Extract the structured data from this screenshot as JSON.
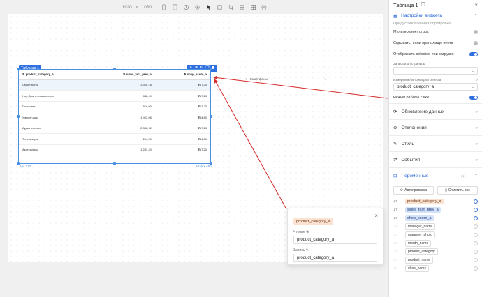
{
  "toolbar": {
    "width": "1920",
    "times": "×",
    "height": "1080",
    "code_icon_label": "{x}"
  },
  "widget": {
    "tag": "Таблица 1",
    "size_left": "1px 310",
    "size_right": "1016 × 460",
    "columns": [
      "product_category_a",
      "sales_fact_prev_a",
      "shop_score_a"
    ],
    "rows": [
      [
        "Смартфоны",
        "3 328,18",
        "₽17,20"
      ],
      [
        "Ноутбуки и компьютеры",
        "842,49",
        "₽17,20"
      ],
      [
        "Планшеты",
        "518,00",
        "₽17,20"
      ],
      [
        "Умные часы",
        "1 422,96",
        "₽44,80"
      ],
      [
        "Аудиотехника",
        "2 332,92",
        "₽17,20"
      ],
      [
        "Телевизоры",
        "264,59",
        "₽44,80"
      ],
      [
        "Аксессуары",
        "1 233,40",
        "₽17,20"
      ]
    ]
  },
  "filter_widget": {
    "label": "Смартфоны"
  },
  "popup": {
    "chip": "product_category_a",
    "read_label": "Чтение",
    "read_value": "product_category_a",
    "write_label": "Запись",
    "write_value": "product_category_a"
  },
  "panel": {
    "title": "Таблица 1",
    "settings_header": "Настройки виджета",
    "cut_row": "Предустановленная сортировка",
    "multiselect": "Мультиселект строк",
    "hide_empty": "Скрывать, если хранилище пусто",
    "show_selected": "Отображать selected при загрузке",
    "url_label": "Запись в url страницы",
    "dimension_label": "Измерение/метрика для селекта",
    "dimension_value": "product_category_a",
    "like_mode": "Режим работы с like",
    "data_update": "Обновление данных",
    "deviations": "Отклонения",
    "style": "Стиль",
    "events": "События",
    "variables": "Переменные",
    "autolink": "Автопривязка",
    "clear_all": "Очистить все",
    "variables_list": [
      {
        "name": "product_category_a",
        "kind": "orange"
      },
      {
        "name": "sales_fact_prev_a",
        "kind": "blue"
      },
      {
        "name": "shop_score_a",
        "kind": "blue"
      },
      {
        "name": "manager_name",
        "kind": "plain"
      },
      {
        "name": "manager_photo",
        "kind": "plain"
      },
      {
        "name": "month_name",
        "kind": "plain"
      },
      {
        "name": "product_category",
        "kind": "plain"
      },
      {
        "name": "product_name",
        "kind": "plain"
      },
      {
        "name": "shop_name",
        "kind": "plain"
      }
    ]
  },
  "colors": {
    "accent": "#2f6fe0",
    "arrow": "#d62828",
    "chip_orange": "#fbe1cf",
    "chip_blue": "#d4e2fa"
  }
}
